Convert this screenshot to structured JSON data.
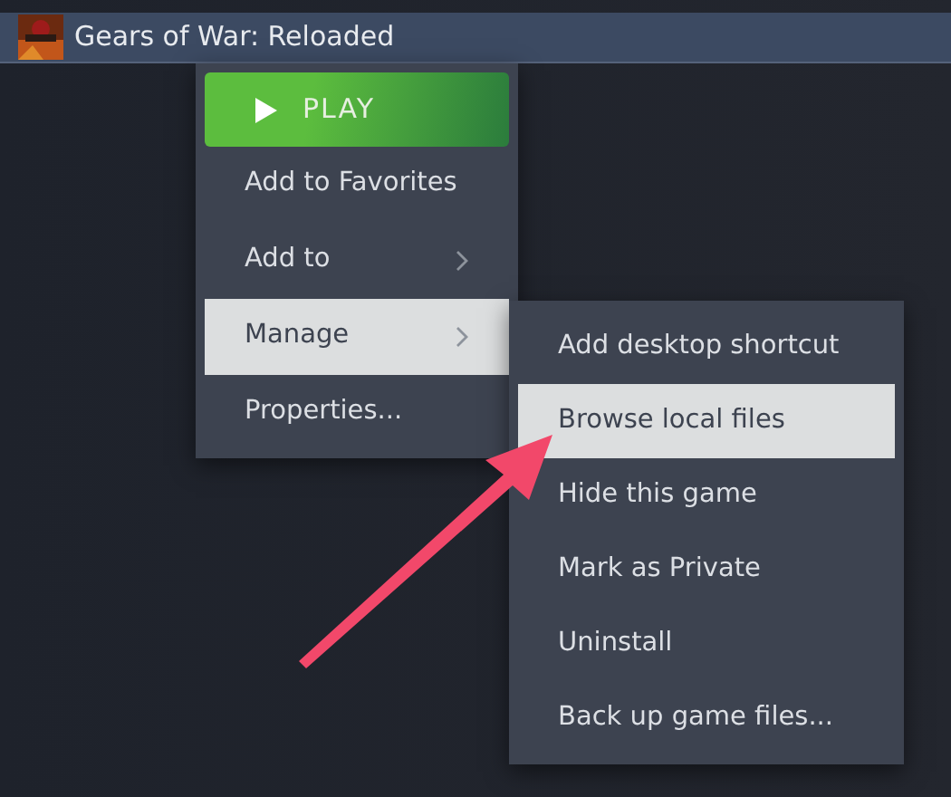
{
  "header": {
    "title": "Gears of War: Reloaded"
  },
  "context_menu": {
    "items": [
      {
        "kind": "play",
        "label": "PLAY",
        "selected": false
      },
      {
        "kind": "item",
        "label": "Add to Favorites",
        "selected": false
      },
      {
        "kind": "submenu",
        "label": "Add to",
        "selected": false
      },
      {
        "kind": "submenu",
        "label": "Manage",
        "selected": true
      },
      {
        "kind": "item",
        "label": "Properties...",
        "selected": false
      }
    ]
  },
  "submenu": {
    "items": [
      {
        "label": "Add desktop shortcut",
        "selected": false
      },
      {
        "label": "Browse local files",
        "selected": true
      },
      {
        "label": "Hide this game",
        "selected": false
      },
      {
        "label": "Mark as Private",
        "selected": false
      },
      {
        "label": "Uninstall",
        "selected": false
      },
      {
        "label": "Back up game files...",
        "selected": false
      }
    ]
  }
}
